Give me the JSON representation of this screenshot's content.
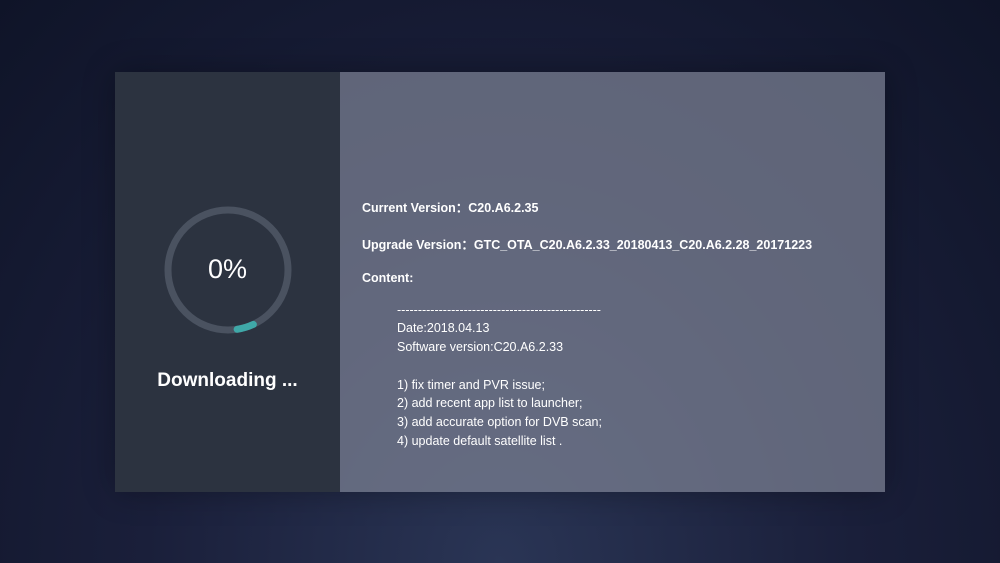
{
  "progress": {
    "percent": "0%",
    "status": "Downloading ..."
  },
  "info": {
    "current_version_label": "Current Version：",
    "current_version_value": "C20.A6.2.35",
    "upgrade_version_label": "Upgrade Version：",
    "upgrade_version_value": "GTC_OTA_C20.A6.2.33_20180413_C20.A6.2.28_20171223",
    "content_label": "Content:",
    "content_body": "-------------------------------------------------\nDate:2018.04.13\nSoftware version:C20.A6.2.33\n\n1) fix timer and PVR issue;\n2) add recent app list to launcher;\n3) add accurate option for DVB scan;\n4) update default satellite list ."
  }
}
